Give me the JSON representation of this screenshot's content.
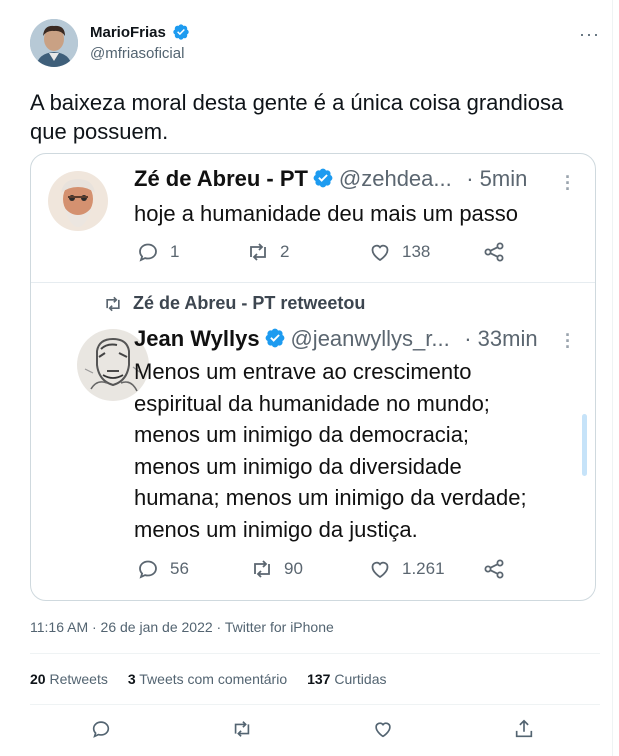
{
  "tweet": {
    "author_name": "MarioFrias",
    "author_handle": "@mfriasoficial",
    "more_label": "···",
    "text": "A baixeza moral desta gente é a única coisa grandiosa que possuem.",
    "timestamp": "11:16 AM · 26 de jan de 2022 · Twitter for iPhone",
    "stats": {
      "retweets_count": "20",
      "retweets_label": "Retweets",
      "quotes_count": "3",
      "quotes_label": "Tweets com comentário",
      "likes_count": "137",
      "likes_label": "Curtidas"
    },
    "accent_color": "#1d9bf0"
  },
  "embedded": {
    "first": {
      "name": "Zé de Abreu - PT",
      "handle": "@zehdea...",
      "time": "· 5min",
      "text": "hoje a humanidade deu mais um passo",
      "replies": "1",
      "retweets": "2",
      "likes": "138"
    },
    "retweet_notice": "Zé de Abreu - PT retweetou",
    "second": {
      "name": "Jean Wyllys",
      "handle": "@jeanwyllys_r...",
      "time": "· 33min",
      "lines": [
        "Menos um entrave ao crescimento",
        "espiritual da humanidade no mundo;",
        "menos um inimigo da democracia;",
        "menos um inimigo da diversidade",
        "humana; menos um inimigo da verdade;",
        "menos um inimigo da justiça."
      ],
      "replies": "56",
      "retweets": "90",
      "likes": "1.261"
    }
  },
  "icons": {
    "verified": "verified-badge-icon",
    "reply": "reply-icon",
    "retweet": "retweet-icon",
    "like": "heart-icon",
    "share": "share-icon",
    "more": "more-icon"
  }
}
